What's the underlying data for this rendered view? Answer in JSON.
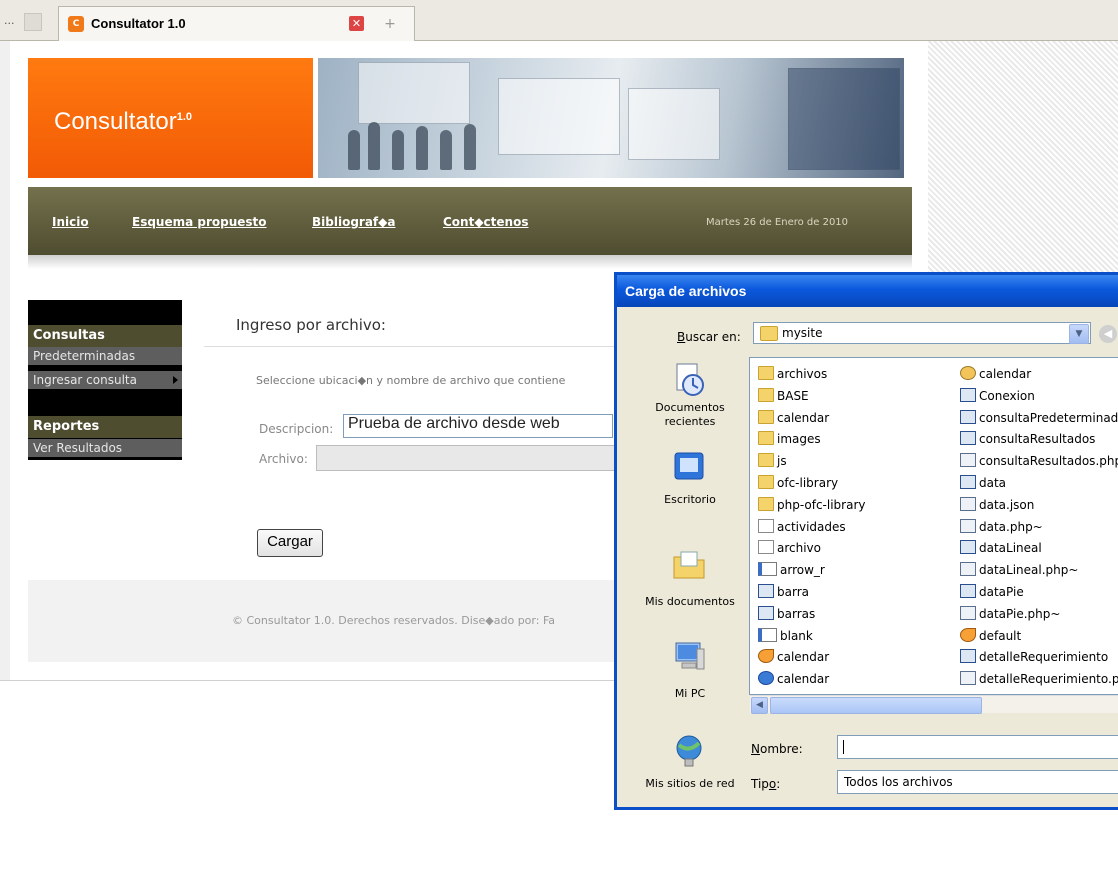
{
  "browser": {
    "more_label": "...",
    "tab_title": "Consultator 1.0",
    "tab_favicon": "consultator-favicon"
  },
  "site": {
    "brand": "Consultator",
    "brand_version": "1.0",
    "nav": [
      {
        "label": "Inicio"
      },
      {
        "label": "Esquema propuesto"
      },
      {
        "label": "Bibliograf◆a"
      },
      {
        "label": "Cont◆ctenos"
      }
    ],
    "date": "Martes 26 de Enero de 2010",
    "sidebar": {
      "section1_title": "Consultas",
      "section1_items": [
        "Predeterminadas",
        "Ingresar consulta"
      ],
      "section2_title": "Reportes",
      "section2_items": [
        "Ver Resultados"
      ]
    },
    "content": {
      "title": "Ingreso por archivo:",
      "instruction": "Seleccione ubicaci◆n y nombre de archivo que contiene",
      "desc_label": "Descripcion:",
      "desc_value": "Prueba de archivo desde web",
      "file_label": "Archivo:",
      "file_value": "",
      "upload_button": "Cargar"
    },
    "footer": "© Consultator 1.0. Derechos reservados. Dise◆ado por: Fa"
  },
  "dialog": {
    "title": "Carga de archivos",
    "lookin_label_hot": "B",
    "lookin_label_rest": "uscar en:",
    "lookin_value": "mysite",
    "places": [
      {
        "label": "Documentos recientes",
        "icon": "recent-documents-icon"
      },
      {
        "label": "Escritorio",
        "icon": "desktop-icon"
      },
      {
        "label": "Mis documentos",
        "icon": "my-documents-icon"
      },
      {
        "label": "Mi PC",
        "icon": "my-computer-icon"
      },
      {
        "label": "Mis sitios de red",
        "icon": "network-places-icon"
      }
    ],
    "files_col1": [
      {
        "name": "archivos",
        "type": "folder"
      },
      {
        "name": "BASE",
        "type": "folder"
      },
      {
        "name": "calendar",
        "type": "folder"
      },
      {
        "name": "images",
        "type": "folder"
      },
      {
        "name": "js",
        "type": "folder"
      },
      {
        "name": "ofc-library",
        "type": "folder"
      },
      {
        "name": "php-ofc-library",
        "type": "folder"
      },
      {
        "name": "actividades",
        "type": "txt"
      },
      {
        "name": "archivo",
        "type": "txt"
      },
      {
        "name": "arrow_r",
        "type": "img"
      },
      {
        "name": "barra",
        "type": "app"
      },
      {
        "name": "barras",
        "type": "app"
      },
      {
        "name": "blank",
        "type": "img"
      },
      {
        "name": "calendar",
        "type": "arrow"
      },
      {
        "name": "calendar",
        "type": "ie"
      }
    ],
    "files_col2": [
      {
        "name": "calendar",
        "type": "gear"
      },
      {
        "name": "Conexion",
        "type": "app"
      },
      {
        "name": "consultaPredeterminad",
        "type": "app"
      },
      {
        "name": "consultaResultados",
        "type": "app"
      },
      {
        "name": "consultaResultados.php",
        "type": "web"
      },
      {
        "name": "data",
        "type": "app"
      },
      {
        "name": "data.json",
        "type": "web"
      },
      {
        "name": "data.php~",
        "type": "web"
      },
      {
        "name": "dataLineal",
        "type": "app"
      },
      {
        "name": "dataLineal.php~",
        "type": "web"
      },
      {
        "name": "dataPie",
        "type": "app"
      },
      {
        "name": "dataPie.php~",
        "type": "web"
      },
      {
        "name": "default",
        "type": "arrow"
      },
      {
        "name": "detalleRequerimiento",
        "type": "app"
      },
      {
        "name": "detalleRequerimiento.p",
        "type": "web"
      }
    ],
    "name_label_hot": "N",
    "name_label_rest": "ombre:",
    "name_value": "",
    "type_label_rest_a": "Tip",
    "type_label_hot": "o",
    "type_label_rest_b": ":",
    "type_value": "Todos los archivos"
  }
}
